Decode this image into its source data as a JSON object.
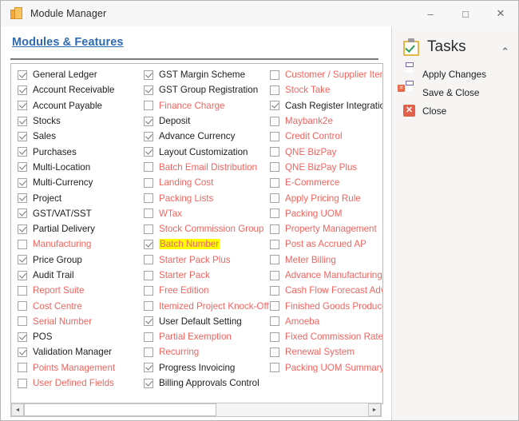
{
  "window": {
    "title": "Module Manager",
    "icon": "boxes-icon",
    "controls": {
      "minimize": "–",
      "maximize": "□",
      "close": "✕"
    }
  },
  "main": {
    "section_title": "Modules & Features",
    "columns": [
      {
        "name": "column-1",
        "items": [
          {
            "label": "General Ledger",
            "checked": true,
            "disabled": false,
            "highlighted": false
          },
          {
            "label": "Account Receivable",
            "checked": true,
            "disabled": false,
            "highlighted": false
          },
          {
            "label": "Account Payable",
            "checked": true,
            "disabled": false,
            "highlighted": false
          },
          {
            "label": "Stocks",
            "checked": true,
            "disabled": false,
            "highlighted": false
          },
          {
            "label": "Sales",
            "checked": true,
            "disabled": false,
            "highlighted": false
          },
          {
            "label": "Purchases",
            "checked": true,
            "disabled": false,
            "highlighted": false
          },
          {
            "label": "Multi-Location",
            "checked": true,
            "disabled": false,
            "highlighted": false
          },
          {
            "label": "Multi-Currency",
            "checked": true,
            "disabled": false,
            "highlighted": false
          },
          {
            "label": "Project",
            "checked": true,
            "disabled": false,
            "highlighted": false
          },
          {
            "label": "GST/VAT/SST",
            "checked": true,
            "disabled": false,
            "highlighted": false
          },
          {
            "label": "Partial Delivery",
            "checked": true,
            "disabled": false,
            "highlighted": false
          },
          {
            "label": "Manufacturing",
            "checked": false,
            "disabled": true,
            "highlighted": false
          },
          {
            "label": "Price Group",
            "checked": true,
            "disabled": false,
            "highlighted": false
          },
          {
            "label": "Audit Trail",
            "checked": true,
            "disabled": false,
            "highlighted": false
          },
          {
            "label": "Report Suite",
            "checked": false,
            "disabled": true,
            "highlighted": false
          },
          {
            "label": "Cost Centre",
            "checked": false,
            "disabled": true,
            "highlighted": false
          },
          {
            "label": "Serial Number",
            "checked": false,
            "disabled": true,
            "highlighted": false
          },
          {
            "label": "POS",
            "checked": true,
            "disabled": false,
            "highlighted": false
          },
          {
            "label": "Validation Manager",
            "checked": true,
            "disabled": false,
            "highlighted": false
          },
          {
            "label": "Points Management",
            "checked": false,
            "disabled": true,
            "highlighted": false
          },
          {
            "label": "User Defined Fields",
            "checked": false,
            "disabled": true,
            "highlighted": false
          }
        ]
      },
      {
        "name": "column-2",
        "items": [
          {
            "label": "GST Margin Scheme",
            "checked": true,
            "disabled": false,
            "highlighted": false
          },
          {
            "label": "GST Group Registration",
            "checked": true,
            "disabled": false,
            "highlighted": false
          },
          {
            "label": "Finance Charge",
            "checked": false,
            "disabled": true,
            "highlighted": false
          },
          {
            "label": "Deposit",
            "checked": true,
            "disabled": false,
            "highlighted": false
          },
          {
            "label": "Advance Currency",
            "checked": true,
            "disabled": false,
            "highlighted": false
          },
          {
            "label": "Layout Customization",
            "checked": true,
            "disabled": false,
            "highlighted": false
          },
          {
            "label": "Batch Email Distribution",
            "checked": false,
            "disabled": true,
            "highlighted": false
          },
          {
            "label": "Landing Cost",
            "checked": false,
            "disabled": true,
            "highlighted": false
          },
          {
            "label": "Packing Lists",
            "checked": false,
            "disabled": true,
            "highlighted": false
          },
          {
            "label": "WTax",
            "checked": false,
            "disabled": true,
            "highlighted": false
          },
          {
            "label": "Stock Commission Group",
            "checked": false,
            "disabled": true,
            "highlighted": false
          },
          {
            "label": "Batch Number",
            "checked": true,
            "disabled": true,
            "highlighted": true
          },
          {
            "label": "Starter Pack Plus",
            "checked": false,
            "disabled": true,
            "highlighted": false
          },
          {
            "label": "Starter Pack",
            "checked": false,
            "disabled": true,
            "highlighted": false
          },
          {
            "label": "Free Edition",
            "checked": false,
            "disabled": true,
            "highlighted": false
          },
          {
            "label": "Itemized Project Knock-Off",
            "checked": false,
            "disabled": true,
            "highlighted": false
          },
          {
            "label": "User Default Setting",
            "checked": true,
            "disabled": false,
            "highlighted": false
          },
          {
            "label": "Partial Exemption",
            "checked": false,
            "disabled": true,
            "highlighted": false
          },
          {
            "label": "Recurring",
            "checked": false,
            "disabled": true,
            "highlighted": false
          },
          {
            "label": "Progress Invoicing",
            "checked": true,
            "disabled": false,
            "highlighted": false
          },
          {
            "label": "Billing Approvals Control",
            "checked": true,
            "disabled": false,
            "highlighted": false
          }
        ]
      },
      {
        "name": "column-3",
        "items": [
          {
            "label": "Customer / Supplier Item",
            "checked": false,
            "disabled": true,
            "highlighted": false
          },
          {
            "label": "Stock Take",
            "checked": false,
            "disabled": true,
            "highlighted": false
          },
          {
            "label": "Cash Register Integration",
            "checked": true,
            "disabled": false,
            "highlighted": false
          },
          {
            "label": "Maybank2e",
            "checked": false,
            "disabled": true,
            "highlighted": false
          },
          {
            "label": "Credit Control",
            "checked": false,
            "disabled": true,
            "highlighted": false
          },
          {
            "label": "QNE BizPay",
            "checked": false,
            "disabled": true,
            "highlighted": false
          },
          {
            "label": "QNE BizPay Plus",
            "checked": false,
            "disabled": true,
            "highlighted": false
          },
          {
            "label": "E-Commerce",
            "checked": false,
            "disabled": true,
            "highlighted": false
          },
          {
            "label": "Apply Pricing Rule",
            "checked": false,
            "disabled": true,
            "highlighted": false
          },
          {
            "label": "Packing UOM",
            "checked": false,
            "disabled": true,
            "highlighted": false
          },
          {
            "label": "Property Management",
            "checked": false,
            "disabled": true,
            "highlighted": false
          },
          {
            "label": "Post as Accrued AP",
            "checked": false,
            "disabled": true,
            "highlighted": false
          },
          {
            "label": "Meter Billing",
            "checked": false,
            "disabled": true,
            "highlighted": false
          },
          {
            "label": "Advance Manufacturing",
            "checked": false,
            "disabled": true,
            "highlighted": false
          },
          {
            "label": "Cash Flow Forecast Advisor",
            "checked": false,
            "disabled": true,
            "highlighted": false
          },
          {
            "label": "Finished Goods Produce",
            "checked": false,
            "disabled": true,
            "highlighted": false
          },
          {
            "label": "Amoeba",
            "checked": false,
            "disabled": true,
            "highlighted": false
          },
          {
            "label": "Fixed Commission Rates",
            "checked": false,
            "disabled": true,
            "highlighted": false
          },
          {
            "label": "Renewal System",
            "checked": false,
            "disabled": true,
            "highlighted": false
          },
          {
            "label": "Packing UOM Summary",
            "checked": false,
            "disabled": true,
            "highlighted": false
          }
        ]
      }
    ],
    "scrollbar": {
      "left_arrow": "◄",
      "right_arrow": "►"
    }
  },
  "tasks": {
    "title": "Tasks",
    "collapse_glyph": "⌃",
    "items": [
      {
        "label": "Apply Changes",
        "icon": "save-icon"
      },
      {
        "label": "Save & Close",
        "icon": "save-and-close-icon"
      },
      {
        "label": "Close",
        "icon": "close-icon"
      }
    ]
  },
  "colors": {
    "link": "#2f6bb0",
    "disabled_text": "#f2645f",
    "highlight": "#ffff00",
    "accent_orange": "#f2a93b",
    "panel_bg": "#f6f5f4"
  }
}
